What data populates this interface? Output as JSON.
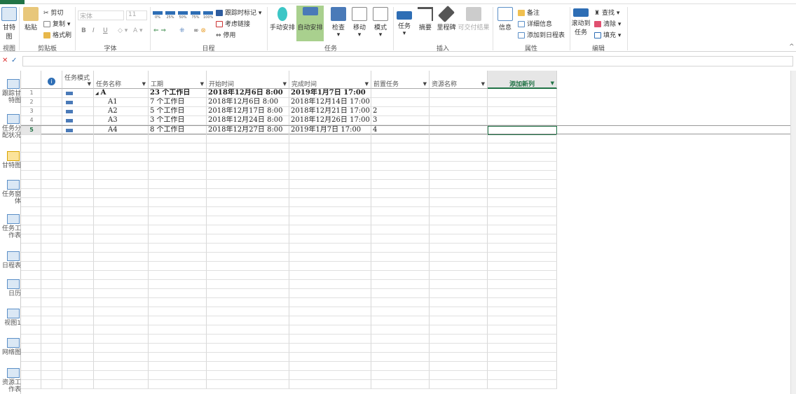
{
  "ribbon": {
    "view": {
      "label": "甘特图",
      "group": "视图"
    },
    "clipboard": {
      "paste": "粘贴",
      "cut": "剪切",
      "copy": "复制",
      "format_painter": "格式刷",
      "group": "剪贴板"
    },
    "font": {
      "name": "宋体",
      "size": "11",
      "bold": "B",
      "italic": "I",
      "underline": "U",
      "group": "字体"
    },
    "schedule": {
      "pcts": [
        "0%",
        "25%",
        "50%",
        "75%",
        "100%"
      ],
      "mark_on_track": "跟踪时标记",
      "respect_links": "考虑链接",
      "inactivate": "停用",
      "group": "日程"
    },
    "tasks": {
      "manual": "手动安排",
      "auto": "自动安排",
      "inspect": "检查",
      "move": "移动",
      "mode": "模式",
      "group": "任务"
    },
    "insert": {
      "task": "任务",
      "summary": "摘要",
      "milestone": "里程碑",
      "deliverable": "可交付结果",
      "group": "插入"
    },
    "properties": {
      "info": "信息",
      "notes": "备注",
      "details": "详细信息",
      "add_timeline": "添加到日程表",
      "group": "属性"
    },
    "editing": {
      "scroll": "滚动到任务",
      "find": "查找",
      "clear": "清除",
      "fill": "填充",
      "group": "编辑"
    }
  },
  "formula": {
    "cancel": "✕",
    "enter": "✓",
    "value": ""
  },
  "viewbar": [
    "跟踪甘特图",
    "任务分配状况",
    "甘特图",
    "任务窗体",
    "任务工作表",
    "日程表",
    "日历",
    "视图1",
    "网络图",
    "资源工作表"
  ],
  "columns": [
    "任务模式",
    "任务名称",
    "工期",
    "开始时间",
    "完成时间",
    "前置任务",
    "资源名称",
    "添加新列"
  ],
  "rows": [
    {
      "id": "1",
      "name": "A",
      "duration": "23 个工作日",
      "start": "2018年12月6日 8:00",
      "finish": "2019年1月7日 17:00",
      "pred": "",
      "summary": true
    },
    {
      "id": "2",
      "name": "A1",
      "duration": "7 个工作日",
      "start": "2018年12月6日 8:00",
      "finish": "2018年12月14日 17:00",
      "pred": ""
    },
    {
      "id": "3",
      "name": "A2",
      "duration": "5 个工作日",
      "start": "2018年12月17日 8:00",
      "finish": "2018年12月21日 17:00",
      "pred": "2"
    },
    {
      "id": "4",
      "name": "A3",
      "duration": "3 个工作日",
      "start": "2018年12月24日 8:00",
      "finish": "2018年12月26日 17:00",
      "pred": "3"
    },
    {
      "id": "5",
      "name": "A4",
      "duration": "8 个工作日",
      "start": "2018年12月27日 8:00",
      "finish": "2019年1月7日 17:00",
      "pred": "4"
    }
  ],
  "colors": {
    "accent": "#217346",
    "active": "#a9d08e"
  }
}
